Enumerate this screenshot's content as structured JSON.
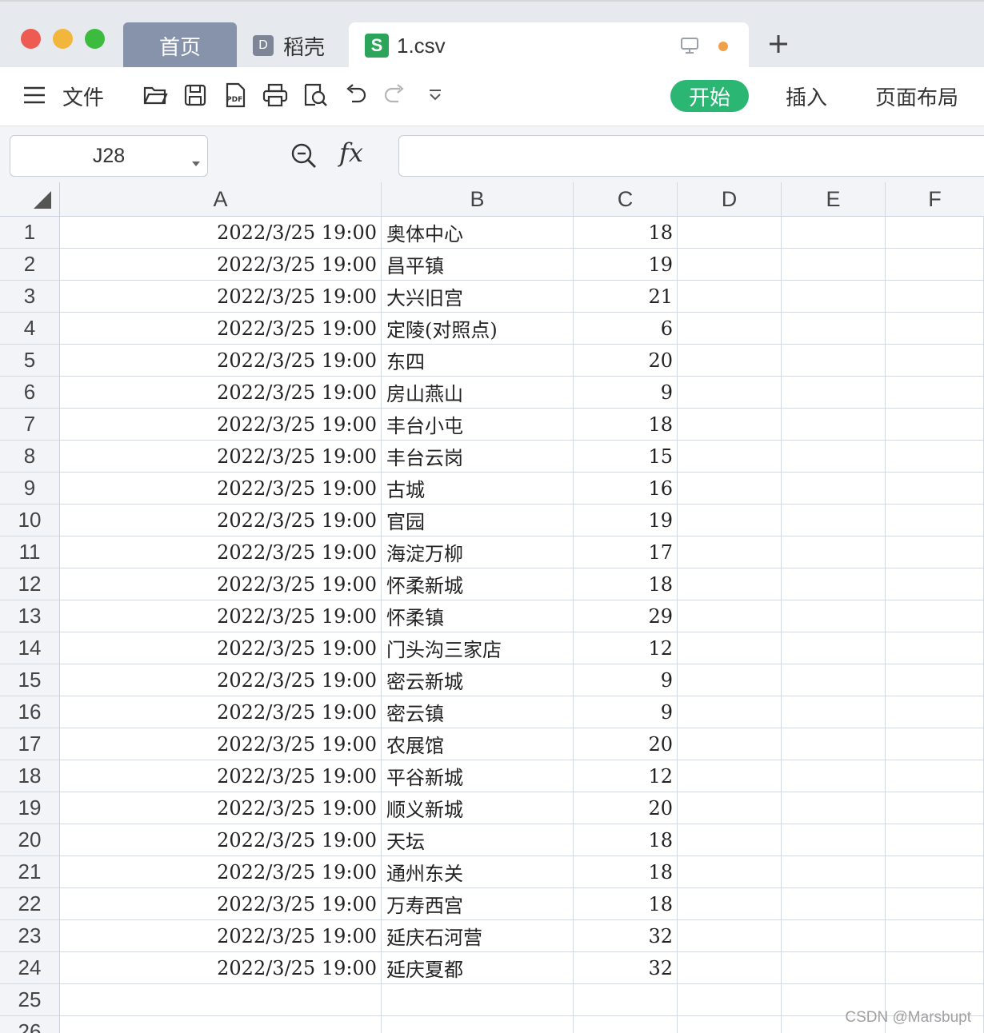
{
  "titlebar": {
    "tabs": {
      "home": "首页",
      "daoke": "稻壳",
      "file": "1.csv"
    }
  },
  "toolbar": {
    "file_menu": "文件",
    "start": "开始",
    "insert": "插入",
    "page_layout": "页面布局"
  },
  "formula_bar": {
    "name_box": "J28",
    "fx": "fx",
    "formula_value": ""
  },
  "sheet": {
    "columns": [
      "A",
      "B",
      "C",
      "D",
      "E",
      "F"
    ],
    "rows": [
      {
        "n": "1",
        "a": "2022/3/25 19:00",
        "b": "奥体中心",
        "c": "18"
      },
      {
        "n": "2",
        "a": "2022/3/25 19:00",
        "b": "昌平镇",
        "c": "19"
      },
      {
        "n": "3",
        "a": "2022/3/25 19:00",
        "b": "大兴旧宫",
        "c": "21"
      },
      {
        "n": "4",
        "a": "2022/3/25 19:00",
        "b": "定陵(对照点)",
        "c": "6"
      },
      {
        "n": "5",
        "a": "2022/3/25 19:00",
        "b": "东四",
        "c": "20"
      },
      {
        "n": "6",
        "a": "2022/3/25 19:00",
        "b": "房山燕山",
        "c": "9"
      },
      {
        "n": "7",
        "a": "2022/3/25 19:00",
        "b": "丰台小屯",
        "c": "18"
      },
      {
        "n": "8",
        "a": "2022/3/25 19:00",
        "b": "丰台云岗",
        "c": "15"
      },
      {
        "n": "9",
        "a": "2022/3/25 19:00",
        "b": "古城",
        "c": "16"
      },
      {
        "n": "10",
        "a": "2022/3/25 19:00",
        "b": "官园",
        "c": "19"
      },
      {
        "n": "11",
        "a": "2022/3/25 19:00",
        "b": "海淀万柳",
        "c": "17"
      },
      {
        "n": "12",
        "a": "2022/3/25 19:00",
        "b": "怀柔新城",
        "c": "18"
      },
      {
        "n": "13",
        "a": "2022/3/25 19:00",
        "b": "怀柔镇",
        "c": "29"
      },
      {
        "n": "14",
        "a": "2022/3/25 19:00",
        "b": "门头沟三家店",
        "c": "12"
      },
      {
        "n": "15",
        "a": "2022/3/25 19:00",
        "b": "密云新城",
        "c": "9"
      },
      {
        "n": "16",
        "a": "2022/3/25 19:00",
        "b": "密云镇",
        "c": "9"
      },
      {
        "n": "17",
        "a": "2022/3/25 19:00",
        "b": "农展馆",
        "c": "20"
      },
      {
        "n": "18",
        "a": "2022/3/25 19:00",
        "b": "平谷新城",
        "c": "12"
      },
      {
        "n": "19",
        "a": "2022/3/25 19:00",
        "b": "顺义新城",
        "c": "20"
      },
      {
        "n": "20",
        "a": "2022/3/25 19:00",
        "b": "天坛",
        "c": "18"
      },
      {
        "n": "21",
        "a": "2022/3/25 19:00",
        "b": "通州东关",
        "c": "18"
      },
      {
        "n": "22",
        "a": "2022/3/25 19:00",
        "b": "万寿西宫",
        "c": "18"
      },
      {
        "n": "23",
        "a": "2022/3/25 19:00",
        "b": "延庆石河营",
        "c": "32"
      },
      {
        "n": "24",
        "a": "2022/3/25 19:00",
        "b": "延庆夏都",
        "c": "32"
      },
      {
        "n": "25",
        "a": "",
        "b": "",
        "c": ""
      },
      {
        "n": "26",
        "a": "",
        "b": "",
        "c": ""
      }
    ]
  },
  "watermark": "CSDN @Marsbupt",
  "colors": {
    "start_button": "#2bb673",
    "active_tab": "#8693ab",
    "red_light": "#ee5b52",
    "yellow_light": "#f3b63c",
    "green_light": "#3dbb3f",
    "unsaved_dot": "#f0a04b",
    "csv_icon": "#2aa55a"
  },
  "icons": [
    "menu-icon",
    "open-folder-icon",
    "save-icon",
    "export-pdf-icon",
    "print-icon",
    "print-preview-icon",
    "undo-icon",
    "redo-icon",
    "more-dropdown-icon",
    "zoom-icon",
    "monitor-icon",
    "add-tab-icon",
    "select-all-triangle-icon"
  ]
}
